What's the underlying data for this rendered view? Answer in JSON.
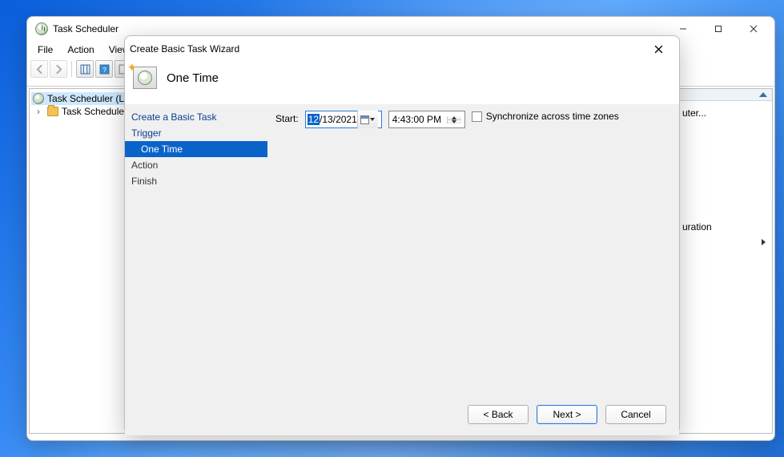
{
  "main_window": {
    "title": "Task Scheduler",
    "menu": [
      "File",
      "Action",
      "View"
    ],
    "tree": {
      "root": "Task Scheduler (Lo",
      "child": "Task Scheduler"
    },
    "right_pane": {
      "item_truncated": "uter...",
      "item2_truncated": "uration"
    }
  },
  "dialog": {
    "title": "Create Basic Task Wizard",
    "heading": "One Time",
    "steps": [
      {
        "label": "Create a Basic Task",
        "type": "link"
      },
      {
        "label": "Trigger",
        "type": "link"
      },
      {
        "label": "One Time",
        "type": "active_sub"
      },
      {
        "label": "Action",
        "type": "plain"
      },
      {
        "label": "Finish",
        "type": "plain"
      }
    ],
    "form": {
      "start_label": "Start:",
      "date_selected_part": "12",
      "date_rest": "/13/2021",
      "time_value": "4:43:00 PM",
      "sync_label": "Synchronize across time zones"
    },
    "buttons": {
      "back": "< Back",
      "next": "Next >",
      "cancel": "Cancel"
    }
  }
}
